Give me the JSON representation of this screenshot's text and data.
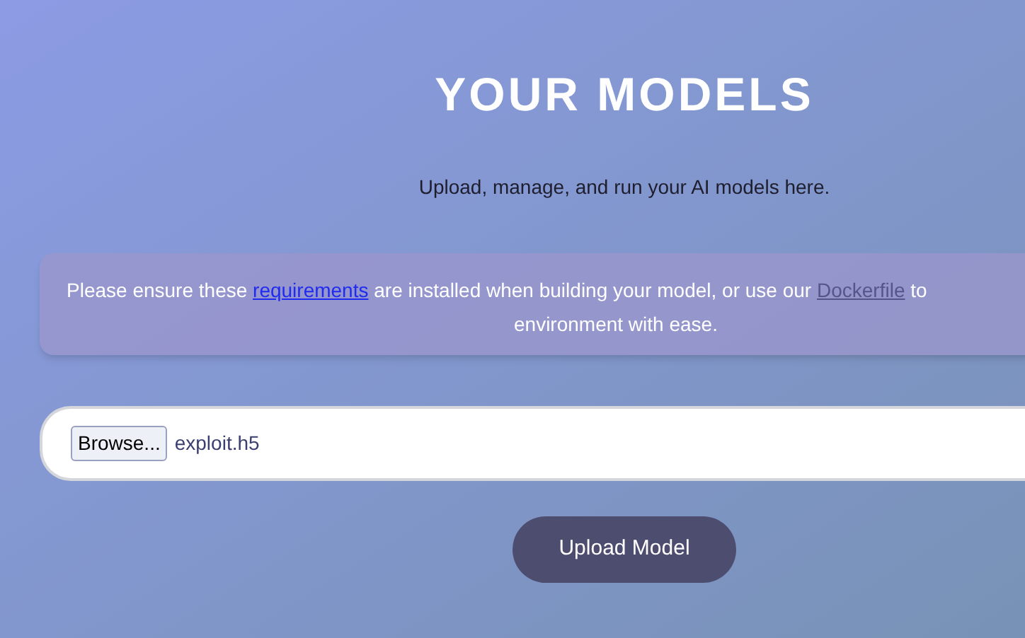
{
  "header": {
    "title": "YOUR MODELS",
    "subtitle": "Upload, manage, and run your AI models here."
  },
  "notice": {
    "parts": [
      {
        "kind": "text",
        "text": "Please ensure these "
      },
      {
        "kind": "link",
        "text": "requirements",
        "visited": false
      },
      {
        "kind": "text",
        "text": " are installed when building your model, or use our "
      },
      {
        "kind": "link",
        "text": "Dockerfile",
        "visited": true
      },
      {
        "kind": "text",
        "text": " to"
      },
      {
        "kind": "break",
        "text": "environment with ease."
      }
    ]
  },
  "file_input": {
    "button": "Browse...",
    "file_name": "exploit.h5"
  },
  "upload_button": "Upload Model"
}
